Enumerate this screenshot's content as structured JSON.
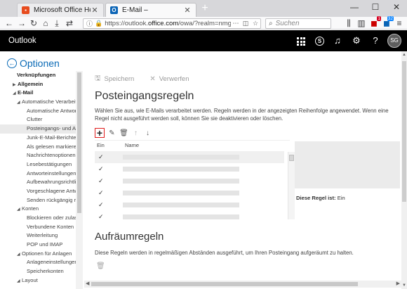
{
  "browser": {
    "tabs": [
      {
        "label": "Microsoft Office Home",
        "favicon": "office-icon"
      },
      {
        "label": "E-Mail –",
        "favicon": "outlook-icon"
      }
    ],
    "url_prefix": "https://outlook.",
    "url_domain": "office.com",
    "url_suffix": "/owa/?realm=nmgz.c",
    "search_placeholder": "Suchen",
    "badge_count_1": "1",
    "badge_count_2": "32"
  },
  "app": {
    "title": "Outlook",
    "avatar_initials": "SG"
  },
  "left_nav": {
    "heading": "Optionen",
    "items": [
      {
        "label": "Verknüpfungen"
      },
      {
        "label": "Allgemein"
      },
      {
        "label": "E-Mail"
      },
      {
        "label": "Automatische Verarbeitung"
      },
      {
        "label": "Automatische Antworten"
      },
      {
        "label": "Clutter"
      },
      {
        "label": "Posteingangs- und Aufräumregeln"
      },
      {
        "label": "Junk-E-Mail-Berichterstattung"
      },
      {
        "label": "Als gelesen markieren"
      },
      {
        "label": "Nachrichtenoptionen"
      },
      {
        "label": "Lesebestätigungen"
      },
      {
        "label": "Antworteinstellungen"
      },
      {
        "label": "Aufbewahrungsrichtlinien"
      },
      {
        "label": "Vorgeschlagene Antworten"
      },
      {
        "label": "Senden rückgängig machen"
      },
      {
        "label": "Konten"
      },
      {
        "label": "Blockieren oder zulassen"
      },
      {
        "label": "Verbundene Konten"
      },
      {
        "label": "Weiterleitung"
      },
      {
        "label": "POP und IMAP"
      },
      {
        "label": "Optionen für Anlagen"
      },
      {
        "label": "Anlageneinstellungen"
      },
      {
        "label": "Speicherkonten"
      },
      {
        "label": "Layout"
      }
    ]
  },
  "main": {
    "toolbar": {
      "save_label": "Speichern",
      "discard_label": "Verwerfen"
    },
    "title": "Posteingangsregeln",
    "description": "Wählen Sie aus, wie E-Mails verarbeitet werden. Regeln werden in der angezeigten Reihenfolge angewendet. Wenn eine Regel nicht ausgeführt werden soll, können Sie sie deaktivieren oder löschen.",
    "table": {
      "col_on": "Ein",
      "col_name": "Name",
      "rows": [
        {
          "enabled": true
        },
        {
          "enabled": true
        },
        {
          "enabled": true
        },
        {
          "enabled": true
        },
        {
          "enabled": true
        },
        {
          "enabled": true
        }
      ]
    },
    "preview": {
      "label": "Diese Regel ist:",
      "value": "Ein"
    },
    "cleanup": {
      "title": "Aufräumregeln",
      "description": "Diese Regeln werden in regelmäßigen Abständen ausgeführt, um Ihren Posteingang aufgeräumt zu halten."
    }
  }
}
